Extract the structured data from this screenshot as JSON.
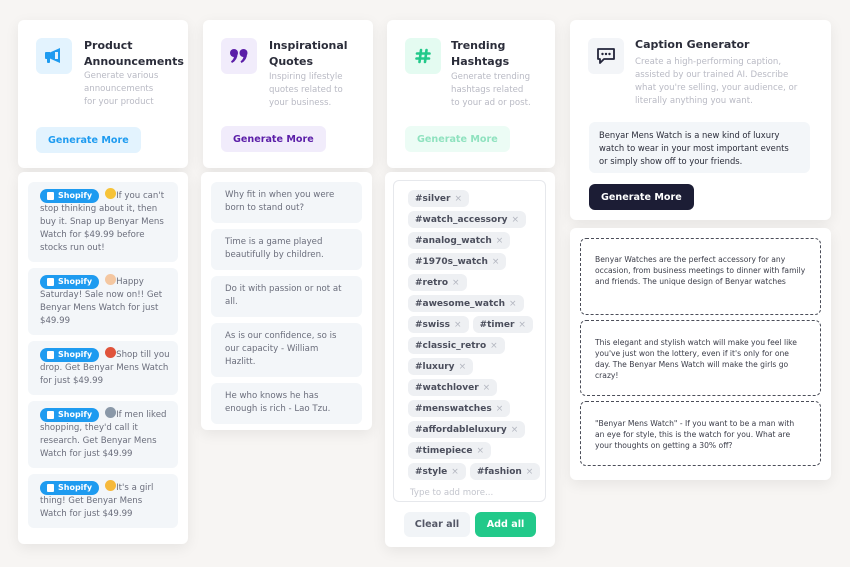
{
  "colors": {
    "background": "#f7f5f3",
    "blue_accent": "#1e9bf0",
    "purple_accent": "#5b1ea8",
    "green_accent": "#22c98a",
    "dark_button": "#1c1d35"
  },
  "cards": {
    "announcements": {
      "icon": "megaphone-icon",
      "title_line1": "Product",
      "title_line2": "Announcements",
      "desc_line1": "Generate various",
      "desc_line2": "announcements",
      "desc_line3": "for your product",
      "button": "Generate More"
    },
    "quotes": {
      "icon": "quote-icon",
      "title_line1": "Inspirational",
      "title_line2": "Quotes",
      "desc_line1": "Inspiring lifestyle",
      "desc_line2": "quotes related to",
      "desc_line3": "your business.",
      "button": "Generate More"
    },
    "hashtags": {
      "icon": "hashtag-icon",
      "title_line1": "Trending",
      "title_line2": "Hashtags",
      "desc_line1": "Generate trending",
      "desc_line2": "hashtags related",
      "desc_line3": "to your ad or post.",
      "button": "Generate More"
    },
    "caption": {
      "icon": "chat-bubble-icon",
      "title": "Caption Generator",
      "desc_line1": "Create a high-performing caption,",
      "desc_line2": "assisted by our trained AI. Describe",
      "desc_line3": "what you're selling, your audience, or",
      "desc_line4": "literally anything you want.",
      "input_value": "Benyar Mens Watch is a new kind of luxury watch to wear in your most important events or simply show off to your friends.",
      "button": "Generate More"
    }
  },
  "announcements": [
    {
      "badge": "Shopify",
      "emoji": "thinking-face",
      "text": "If you can't stop thinking about it, then buy it. Snap up Benyar Mens Watch for $49.99 before stocks run out!"
    },
    {
      "badge": "Shopify",
      "emoji": "waving-hand",
      "text": "Happy Saturday! Sale now on!! Get Benyar Mens Watch for just $49.99"
    },
    {
      "badge": "Shopify",
      "emoji": "dancer",
      "text": "Shop till you drop. Get Benyar Mens Watch for just $49.99"
    },
    {
      "badge": "Shopify",
      "emoji": "microscope",
      "text": "If men liked shopping, they'd call it research. Get Benyar Mens Watch for just $49.99"
    },
    {
      "badge": "Shopify",
      "emoji": "girl-face",
      "text": "It's a girl thing! Get Benyar Mens Watch for just $49.99"
    }
  ],
  "quotes": [
    "Why fit in when you were born to stand out?",
    "Time is a game played beautifully by children.",
    "Do it with passion or not at all.",
    "As is our confidence, so is our capacity - William Hazlitt.",
    "He who knows he has enough is rich - Lao Tzu."
  ],
  "hashtags": {
    "tags": [
      "#silver",
      "#watch_accessory",
      "#analog_watch",
      "#1970s_watch",
      "#retro",
      "#awesome_watch",
      "#swiss",
      "#timer",
      "#classic_retro",
      "#luxury",
      "#watchlover",
      "#menswatches",
      "#affordableluxury",
      "#timepiece",
      "#style",
      "#fashion"
    ],
    "placeholder": "Type to add more...",
    "clear_button": "Clear all",
    "add_button": "Add all",
    "remove_glyph": "×"
  },
  "captions": [
    "Benyar Watches are the perfect accessory for any occasion, from business meetings to dinner with family and friends. The unique design of Benyar watches",
    "This elegant and stylish watch will make you feel like you've just won the lottery, even if it's only for one day. The Benyar Mens Watch will make the girls go crazy!",
    "\"Benyar Mens Watch\" - If you want to be a man with an eye for style, this is the watch for you. What are your thoughts on getting a 30% off?"
  ]
}
